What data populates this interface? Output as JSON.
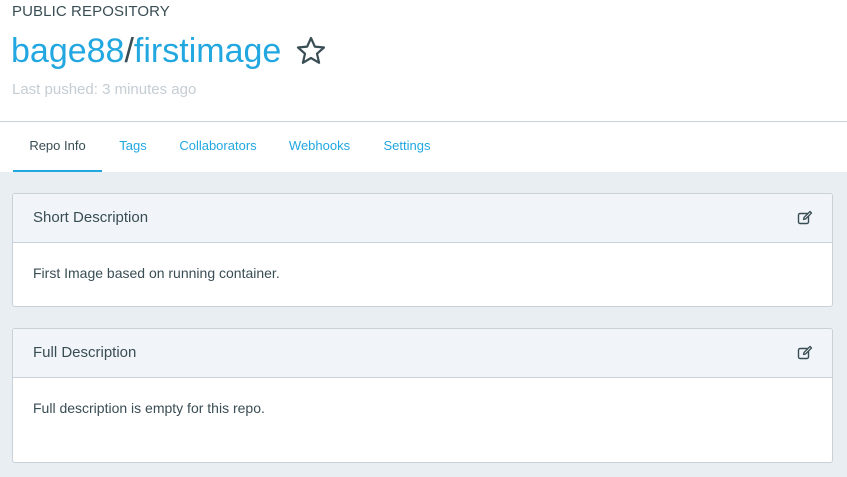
{
  "header": {
    "repo_kind": "PUBLIC REPOSITORY",
    "owner": "bage88",
    "separator": "/",
    "name": "firstimage",
    "star_icon": "star-icon",
    "last_pushed": "Last pushed: 3 minutes ago"
  },
  "tabs": [
    {
      "label": "Repo Info",
      "active": true
    },
    {
      "label": "Tags",
      "active": false
    },
    {
      "label": "Collaborators",
      "active": false
    },
    {
      "label": "Webhooks",
      "active": false
    },
    {
      "label": "Settings",
      "active": false
    }
  ],
  "panels": {
    "short": {
      "title": "Short Description",
      "body": "First Image based on running container.",
      "edit_icon": "edit-icon"
    },
    "full": {
      "title": "Full Description",
      "body": "Full description is empty for this repo.",
      "edit_icon": "edit-icon"
    }
  },
  "colors": {
    "link": "#22a7e0",
    "text": "#394d54",
    "muted": "#c4cdd4",
    "content_bg": "#e9eef3",
    "panel_head_bg": "#f1f5f9",
    "border": "#c9d1d8"
  }
}
